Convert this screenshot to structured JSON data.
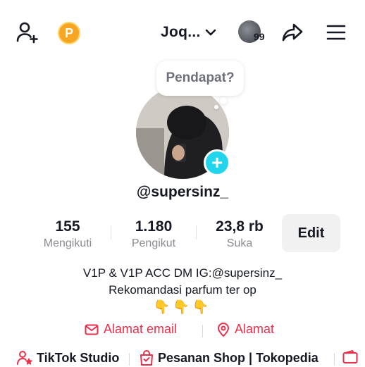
{
  "top_bar": {
    "username": "Joq...",
    "story_count": "99",
    "coin_letter": "P"
  },
  "bubble": {
    "text": "Pendapat?"
  },
  "profile": {
    "handle": "@supersinz_"
  },
  "stats": [
    {
      "value": "155",
      "label": "Mengikuti"
    },
    {
      "value": "1.180",
      "label": "Pengikut"
    },
    {
      "value": "23,8 rb",
      "label": "Suka"
    }
  ],
  "edit_label": "Edit",
  "bio": {
    "line1": "V1P & V1P ACC DM IG:@supersinz_",
    "line2": "Rekomandasi parfum ter op",
    "emojis": "👇👇👇"
  },
  "links": {
    "email": "Alamat email",
    "address": "Alamat"
  },
  "shortcuts": {
    "studio": "TikTok Studio",
    "shop": "Pesanan Shop | Tokopedia"
  },
  "colors": {
    "accent": "#ea2f4a",
    "plus": "#20d5ec",
    "coin": "#f6a623"
  }
}
